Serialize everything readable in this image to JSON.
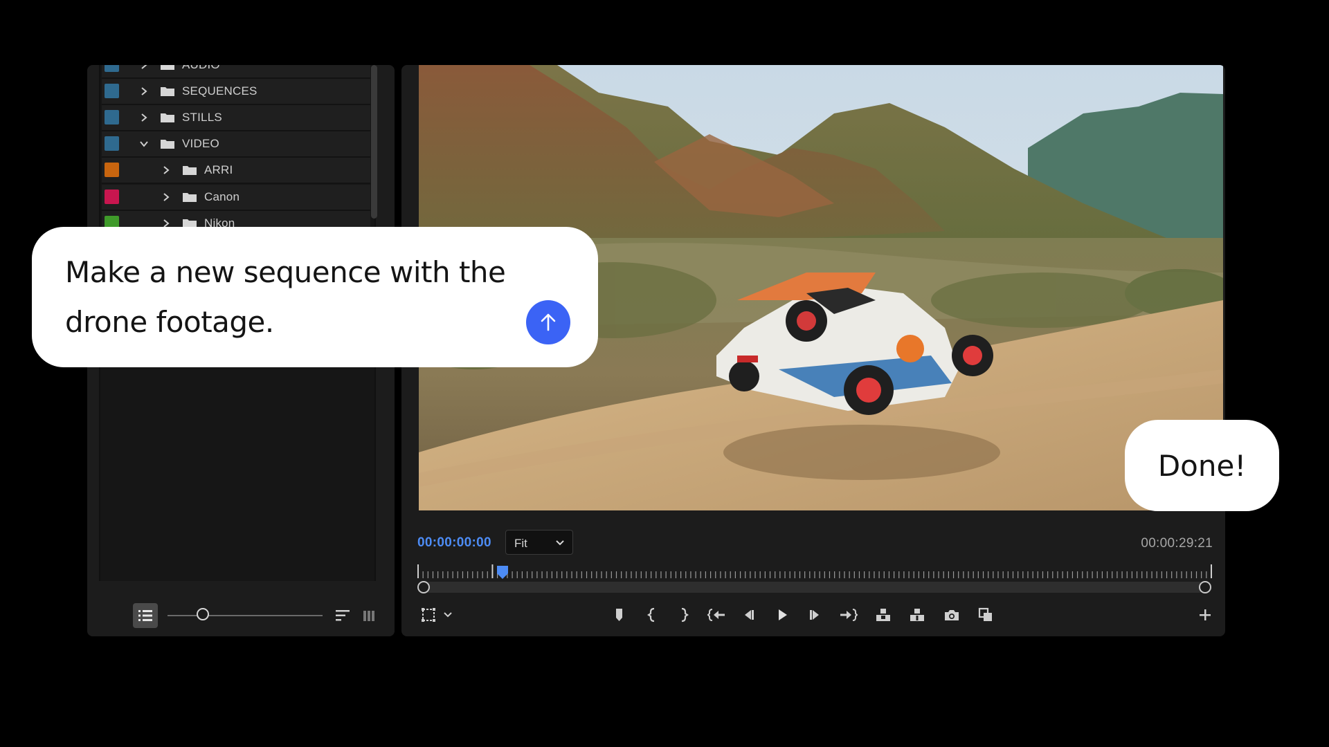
{
  "project_panel": {
    "items": [
      {
        "label": "AUDIO",
        "color": "#2f6a8f",
        "expanded": false,
        "level": 0
      },
      {
        "label": "SEQUENCES",
        "color": "#2f6a8f",
        "expanded": false,
        "level": 0
      },
      {
        "label": "STILLS",
        "color": "#2f6a8f",
        "expanded": false,
        "level": 0
      },
      {
        "label": "VIDEO",
        "color": "#2f6a8f",
        "expanded": true,
        "level": 0
      },
      {
        "label": "ARRI",
        "color": "#c8650f",
        "expanded": false,
        "level": 1
      },
      {
        "label": "Canon",
        "color": "#c8164f",
        "expanded": false,
        "level": 1
      },
      {
        "label": "Nikon",
        "color": "#3f9a2a",
        "expanded": false,
        "level": 1
      }
    ],
    "zoom_level": 0.25,
    "icons": [
      "list-view-icon",
      "zoom-slider",
      "sort-icon",
      "freeform-view-icon"
    ]
  },
  "program_monitor": {
    "timecode_current": "00:00:00:00",
    "fit_value": "Fit",
    "timecode_duration": "00:00:29:21",
    "playhead_position": 0.07,
    "accent_color": "#4d8cf5",
    "transport_icons": [
      "safe-margins-icon",
      "settings-chevron-icon",
      "add-marker-icon",
      "mark-in-icon",
      "mark-out-icon",
      "go-to-in-icon",
      "step-back-icon",
      "play-icon",
      "step-forward-icon",
      "go-to-out-icon",
      "lift-icon",
      "extract-icon",
      "export-frame-icon",
      "comparison-view-icon",
      "add-button-icon"
    ]
  },
  "chat": {
    "prompt": "Make a new sequence with the drone footage.",
    "response": "Done!",
    "send_color": "#3b63f5"
  }
}
